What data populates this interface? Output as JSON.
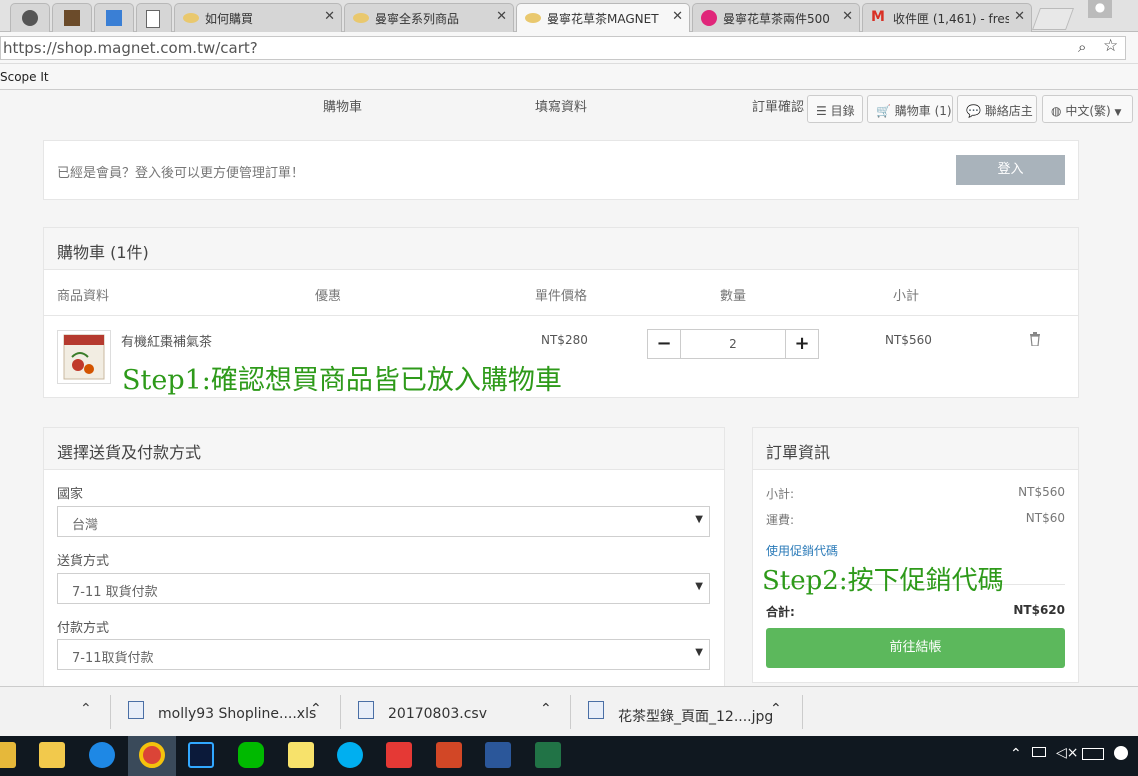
{
  "browser": {
    "tabs": [
      {
        "label": "",
        "icon": "chrome-icon"
      },
      {
        "label": "",
        "icon": "app-icon"
      },
      {
        "label": "",
        "icon": "chart-icon"
      },
      {
        "label": "",
        "icon": "page-icon"
      },
      {
        "label": "如何購買",
        "icon": "magnet-icon"
      },
      {
        "label": "曼寧全系列商品",
        "icon": "magnet-icon"
      },
      {
        "label": "曼寧花草茶MAGNET",
        "icon": "magnet-icon",
        "active": true
      },
      {
        "label": "曼寧花草茶兩件500",
        "icon": "alert-icon"
      },
      {
        "label": "收件匣 (1,461) - fres",
        "icon": "gmail-icon"
      }
    ],
    "close_glyph": "✕",
    "url": "https://shop.magnet.com.tw/cart?",
    "bookmark": "Scope It"
  },
  "nav": {
    "steps": [
      "購物車",
      "填寫資料",
      "訂單確認"
    ],
    "catalog": "目錄",
    "cart": "購物車 (1)",
    "contact": "聯絡店主",
    "language": "中文(繁)"
  },
  "login": {
    "message": "已經是會員？登入後可以更方便管理訂單！",
    "button": "登入"
  },
  "cart": {
    "title": "購物車  (1件)",
    "columns": [
      "商品資料",
      "優惠",
      "單件價格",
      "數量",
      "小計"
    ],
    "item": {
      "name": "有機紅棗補氣茶",
      "unit_price": "NT$280",
      "quantity": "2",
      "subtotal": "NT$560",
      "minus": "−",
      "plus": "+"
    }
  },
  "shipping": {
    "title": "選擇送貨及付款方式",
    "country_label": "國家",
    "country_value": "台灣",
    "method_label": "送貨方式",
    "method_value": "7-11 取貨付款",
    "payment_label": "付款方式",
    "payment_value": "7-11取貨付款"
  },
  "order": {
    "title": "訂單資訊",
    "subtotal_label": "小計:",
    "subtotal_value": "NT$560",
    "shipping_label": "運費:",
    "shipping_value": "NT$60",
    "promo_link": "使用促銷代碼",
    "total_label": "合計:",
    "total_value": "NT$620",
    "checkout": "前往結帳"
  },
  "annotations": {
    "step1": "Step1:確認想買商品皆已放入購物車",
    "step2": "Step2:按下促銷代碼",
    "color": "#2e9a1a"
  },
  "downloads": [
    {
      "name": "molly93 Shopline....xls"
    },
    {
      "name": "20170803.csv"
    },
    {
      "name": "花茶型錄_頁面_12....jpg"
    }
  ],
  "colors": {
    "checkout_green": "#5cb85c",
    "login_gray": "#a9b3bb"
  }
}
